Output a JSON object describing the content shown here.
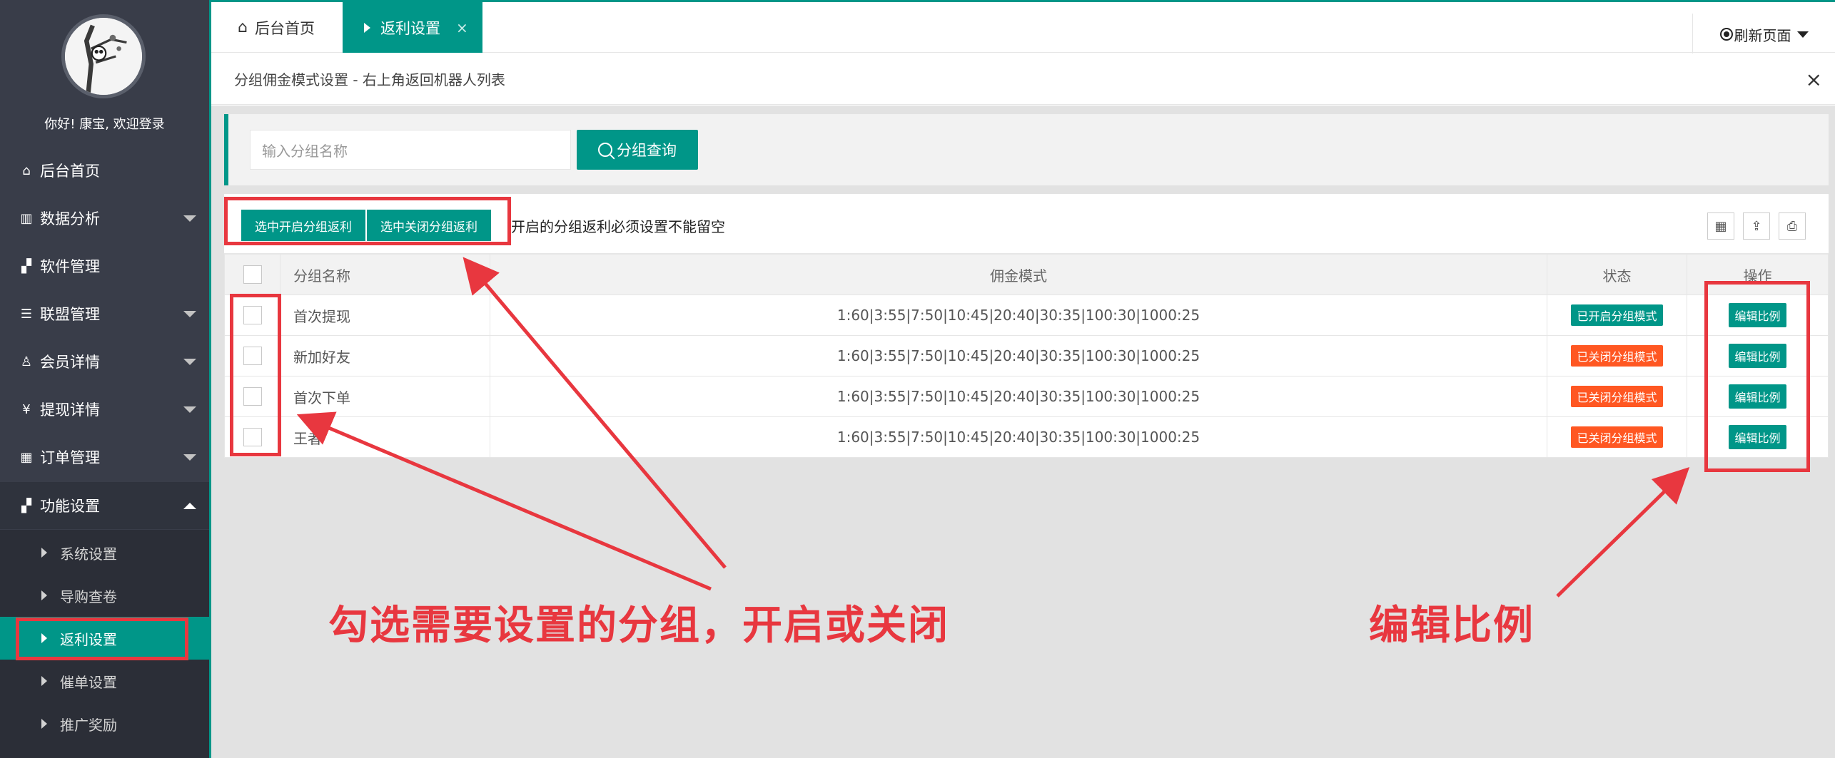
{
  "sidebar": {
    "welcome": "你好! 康宝, 欢迎登录",
    "nav": [
      {
        "label": "后台首页",
        "icon": "home-icon"
      },
      {
        "label": "数据分析",
        "icon": "book-icon"
      },
      {
        "label": "软件管理",
        "icon": "apps-icon"
      },
      {
        "label": "联盟管理",
        "icon": "list-icon"
      },
      {
        "label": "会员详情",
        "icon": "user-icon"
      },
      {
        "label": "提现详情",
        "icon": "yen-icon"
      },
      {
        "label": "订单管理",
        "icon": "grid-icon"
      },
      {
        "label": "功能设置",
        "icon": "apps-icon"
      }
    ],
    "sub": [
      "系统设置",
      "导购查卷",
      "返利设置",
      "催单设置",
      "推广奖励"
    ]
  },
  "tabs": {
    "home": "后台首页",
    "active": "返利设置",
    "close": "×"
  },
  "refresh": "刷新页面",
  "page": {
    "title": "分组佣金模式设置 - 右上角返回机器人列表",
    "close": "×"
  },
  "search": {
    "placeholder": "输入分组名称",
    "button": "分组查询"
  },
  "toolbar": {
    "enable": "选中开启分组返利",
    "disable": "选中关闭分组返利",
    "note": "开启的分组返利必须设置不能留空"
  },
  "table": {
    "headers": {
      "name": "分组名称",
      "mode": "佣金模式",
      "status": "状态",
      "op": "操作"
    },
    "rows": [
      {
        "name": "首次提现",
        "mode": "1:60|3:55|7:50|10:45|20:40|30:35|100:30|1000:25",
        "status": "已开启分组模式",
        "op": "编辑比例"
      },
      {
        "name": "新加好友",
        "mode": "1:60|3:55|7:50|10:45|20:40|30:35|100:30|1000:25",
        "status": "已关闭分组模式",
        "op": "编辑比例"
      },
      {
        "name": "首次下单",
        "mode": "1:60|3:55|7:50|10:45|20:40|30:35|100:30|1000:25",
        "status": "已关闭分组模式",
        "op": "编辑比例"
      },
      {
        "name": "王者",
        "mode": "1:60|3:55|7:50|10:45|20:40|30:35|100:30|1000:25",
        "status": "已关闭分组模式",
        "op": "编辑比例"
      }
    ]
  },
  "annotations": {
    "left": "勾选需要设置的分组，开启或关闭",
    "right": "编辑比例"
  },
  "colors": {
    "accent": "#009688",
    "sidebar": "#393d49",
    "off": "#ff5722",
    "annotation": "#e8373f"
  }
}
